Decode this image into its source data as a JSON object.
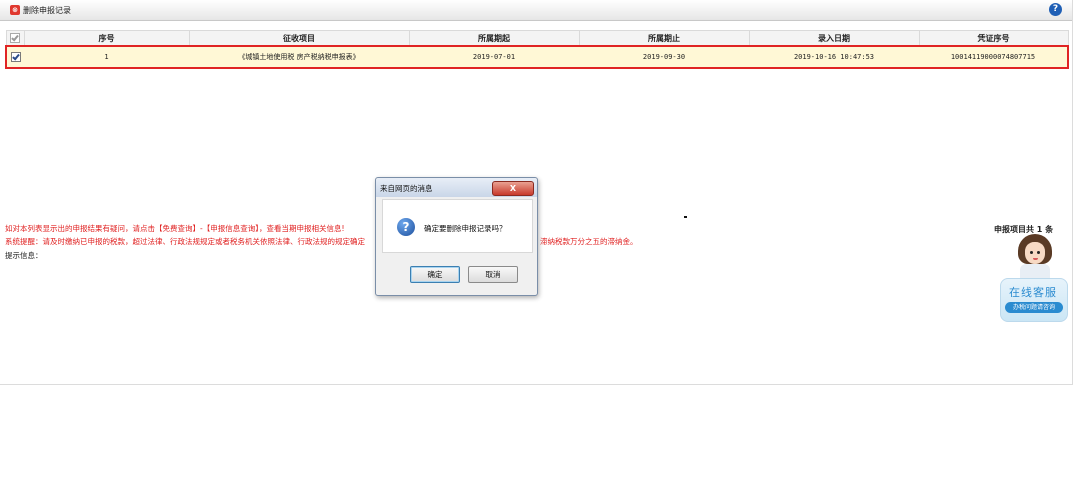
{
  "window": {
    "title": "删除申报记录",
    "help_icon": "help-icon"
  },
  "table": {
    "columns": [
      "序号",
      "征收项目",
      "所属期起",
      "所属期止",
      "录入日期",
      "凭证序号"
    ],
    "rows": [
      {
        "checked": true,
        "seq": "1",
        "item": "《城镇土地使用税 房产税纳税申报表》",
        "period_start": "2019-07-01",
        "period_end": "2019-09-30",
        "entry_date": "2019-10-16 10:47:53",
        "voucher": "10014119000074807715"
      }
    ]
  },
  "notices": {
    "line1": "如对本列表显示出的申报结果有疑问，请点击【免费查询】-【申报信息查询】，查看当期申报相关信息!",
    "line2_left": "系统提醒：请及时缴纳已申报的税款，超过法律、行政法规规定或者税务机关依照法律、行政法规的规定确定",
    "line2_right": "滞纳税款万分之五的滞纳金。",
    "line3": "提示信息：",
    "count": "申报项目共 1 条"
  },
  "dialog": {
    "title": "来自网页的消息",
    "close_label": "X",
    "message": "确定要删除申报记录吗？",
    "ok_label": "确定",
    "cancel_label": "取消"
  },
  "service": {
    "title": "在线客服",
    "subtitle": "办税问题请咨询"
  },
  "colors": {
    "highlight_border": "#e02424",
    "row_bg": "#fff8d6",
    "notice_red": "#e02020",
    "accent_blue": "#2a8bd0"
  }
}
